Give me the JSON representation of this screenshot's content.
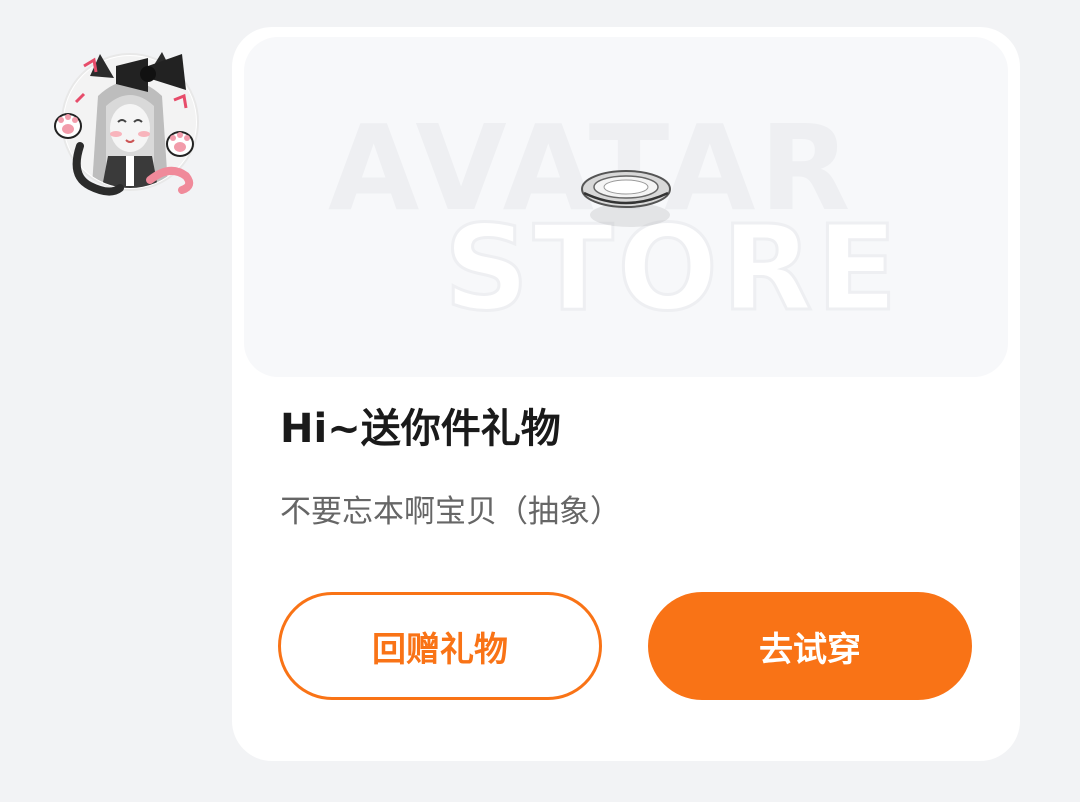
{
  "avatar": {
    "alt": "cat-ear girl avatar"
  },
  "banner": {
    "watermark_line1": "AVATAR",
    "watermark_line2": "STORE",
    "item_icon": "plate-icon"
  },
  "gift": {
    "title": "Hi~送你件礼物",
    "subtitle": "不要忘本啊宝贝（抽象）"
  },
  "actions": {
    "return_gift_label": "回赠礼物",
    "try_on_label": "去试穿"
  },
  "colors": {
    "accent": "#f97316",
    "background": "#f2f3f5",
    "card": "#ffffff"
  }
}
